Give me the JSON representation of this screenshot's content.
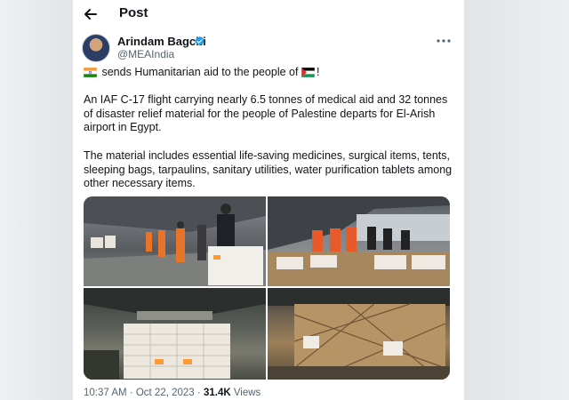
{
  "header": {
    "title": "Post"
  },
  "post": {
    "author_name": "Arindam Bagchi",
    "handle": "@MEAIndia",
    "line1_text": "sends Humanitarian aid to the people of",
    "line1_end": "!",
    "paragraph2": "An IAF C-17 flight carrying nearly 6.5 tonnes of medical aid and 32 tonnes of disaster relief material for the people of Palestine departs for El-Arish airport in Egypt.",
    "paragraph3": "The material includes essential life-saving medicines, surgical items, tents, sleeping bags, tarpaulins, sanitary utilities, water purification tablets among other necessary items.",
    "time": "10:37 AM",
    "separator": "·",
    "date": "Oct 22, 2023",
    "views_count": "31.4K",
    "views_label": "Views"
  },
  "icons": [
    "back-arrow-icon",
    "verified-badge-icon",
    "more-options-icon",
    "india-flag-icon",
    "palestine-flag-icon"
  ],
  "colors": {
    "verified": "#1d9bf0",
    "text": "#0f1419",
    "secondary": "#536471",
    "background": "#ffffff"
  }
}
